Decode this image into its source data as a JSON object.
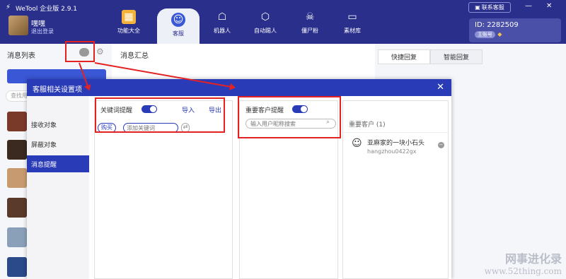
{
  "app": {
    "title": "WeTool 企业版 2.9.1"
  },
  "user": {
    "name": "嘿嘿",
    "logout": "退出登录"
  },
  "nav": [
    {
      "label": "功能大全",
      "icon": "grid-icon"
    },
    {
      "label": "客服",
      "icon": "headset-icon"
    },
    {
      "label": "机器人",
      "icon": "robot-icon"
    },
    {
      "label": "自动踢人",
      "icon": "kick-icon"
    },
    {
      "label": "僵尸粉",
      "icon": "skull-icon"
    },
    {
      "label": "素材库",
      "icon": "folder-icon"
    }
  ],
  "contact_support": "联系客服",
  "account": {
    "id": "ID: 2282509",
    "version": "主账号"
  },
  "bg": {
    "msg_list": "消息列表",
    "msg_btn": "消息汇总",
    "search": "查找用",
    "msg_summary": "消息汇总",
    "tabs": [
      "快捷回复",
      "智能回复"
    ]
  },
  "modal": {
    "title": "客服相关设置项",
    "sidebar": [
      "接收对象",
      "屏蔽对象",
      "消息提醒"
    ],
    "keyword": {
      "label": "关键词提醒",
      "import": "导入",
      "export": "导出",
      "tag": "购买",
      "placeholder": "添加关键词"
    },
    "important": {
      "label": "重要客户提醒",
      "placeholder": "输入用户昵称搜索",
      "list_title": "重要客户 (1)",
      "customer_name": "亚麻家的一块小石头",
      "customer_id": "hangzhou0422gx"
    }
  },
  "watermark": {
    "line1": "网事进化录",
    "line2": "www.52thing.com"
  }
}
